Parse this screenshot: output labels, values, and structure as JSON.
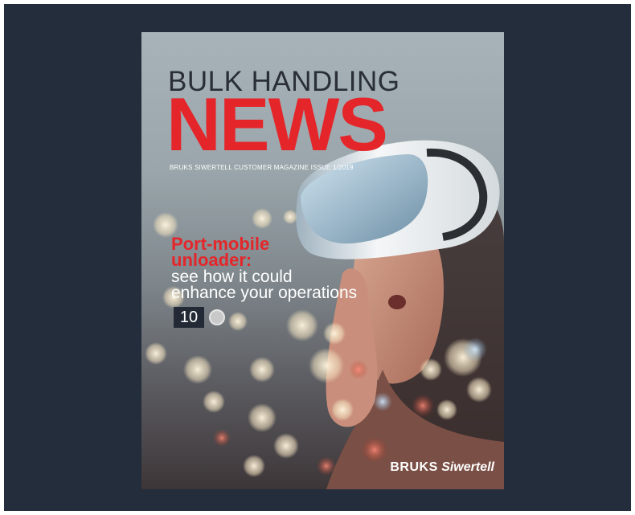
{
  "cover": {
    "masthead_top": "BULK HANDLING",
    "masthead_main": "NEWS",
    "issue_line": "BRUKS SIWERTELL CUSTOMER MAGAZINE ISSUE 1/2019",
    "headline_red_1": "Port-mobile",
    "headline_red_2": "unloader:",
    "headline_white_1": "see how it could",
    "headline_white_2": "enhance your operations",
    "page_number": "10",
    "brand_part1": "BRUKS",
    "brand_part2": "Siwertell"
  },
  "colors": {
    "frame_bg": "#232d3b",
    "accent_red": "#e4262a",
    "masthead_dark": "#2a2f36",
    "page_box": "#232a36"
  },
  "icons": [
    "arrow-circle-icon",
    "vr-headset"
  ]
}
